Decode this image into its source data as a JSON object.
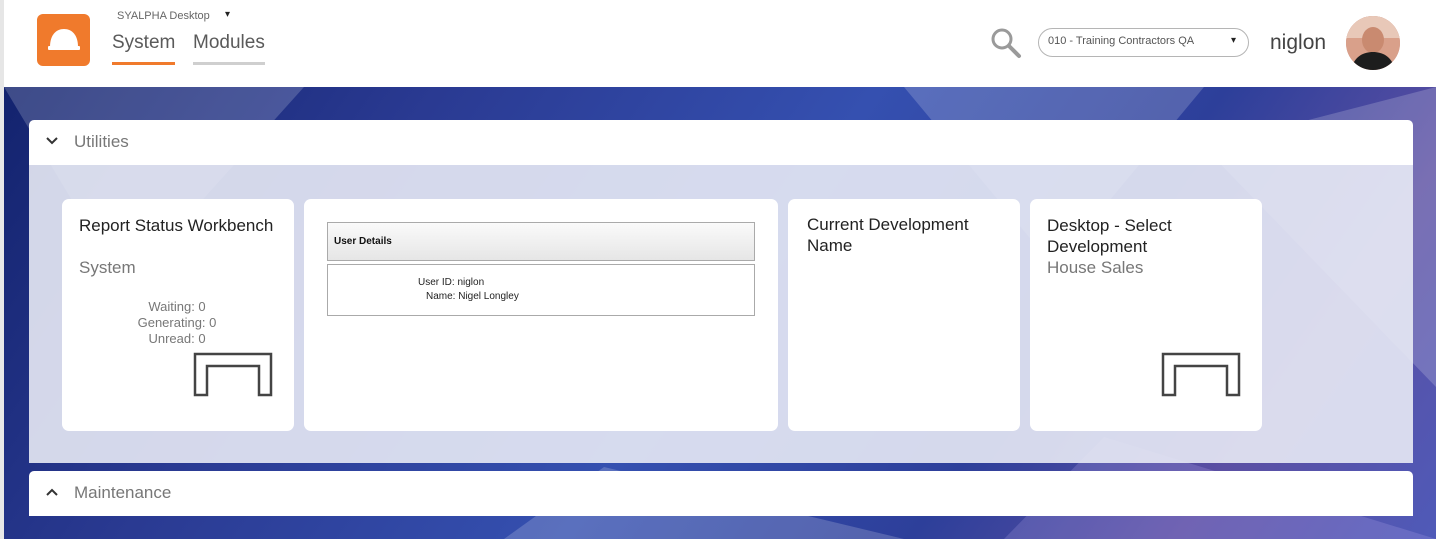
{
  "header": {
    "app_title": "SYALPHA Desktop",
    "app_caret": "▾",
    "tabs": [
      {
        "label": "System",
        "active": true
      },
      {
        "label": "Modules",
        "active": false
      }
    ],
    "context_value": "010 - Training Contractors QA",
    "context_caret": "▾",
    "username": "niglon"
  },
  "colors": {
    "accent": "#f07a2c",
    "background": "#2a3a92"
  },
  "panels": {
    "utilities": {
      "title": "Utilities",
      "expanded": true,
      "icon": "chevron-down-icon"
    },
    "maintenance": {
      "title": "Maintenance",
      "expanded": false,
      "icon": "chevron-up-icon"
    }
  },
  "tiles": {
    "report_status": {
      "title": "Report Status Workbench",
      "subtitle": "System",
      "waiting": "Waiting: 0",
      "generating": "Generating: 0",
      "unread": "Unread: 0"
    },
    "user_details": {
      "header": "User Details",
      "user_id": "User ID: niglon",
      "name": "Name: Nigel Longley"
    },
    "current_development": {
      "title": "Current Development Name"
    },
    "select_development": {
      "title": "Desktop - Select Development",
      "subtitle": "House Sales"
    }
  }
}
